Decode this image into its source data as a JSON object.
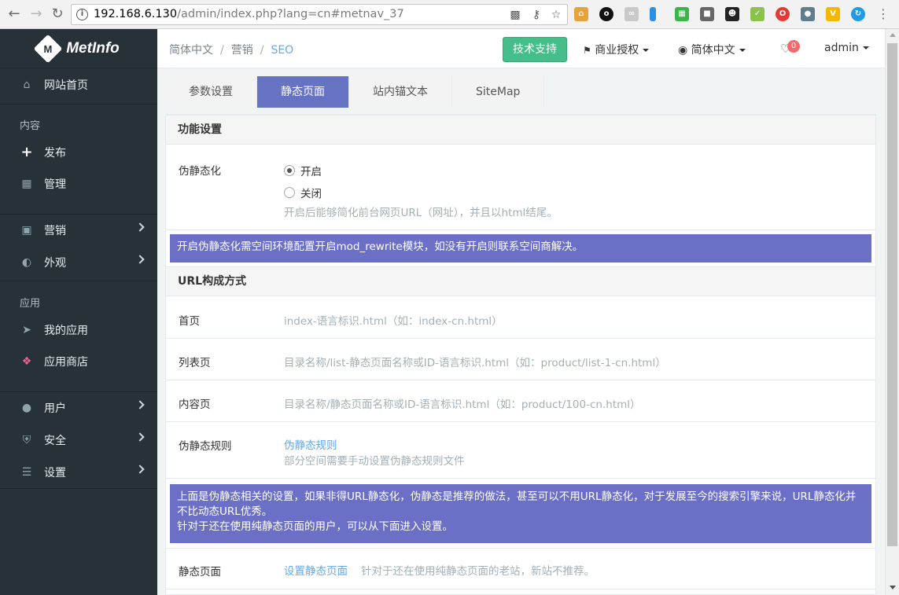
{
  "browser": {
    "url_host": "192.168.6.130",
    "url_path": "/admin/index.php?lang=cn#metnav_37"
  },
  "sidebar": {
    "brand": "MetInfo",
    "home": "网站首页",
    "group_content": "内容",
    "publish": "发布",
    "manage": "管理",
    "marketing": "营销",
    "appearance": "外观",
    "group_apps": "应用",
    "my_apps": "我的应用",
    "app_store": "应用商店",
    "users": "用户",
    "security": "安全",
    "settings": "设置"
  },
  "topbar": {
    "breadcrumb": [
      "简体中文",
      "营销",
      "SEO"
    ],
    "support_button": "技术支持",
    "license": "商业授权",
    "language": "简体中文",
    "notification_count": "0",
    "user": "admin"
  },
  "tabs": [
    "参数设置",
    "静态页面",
    "站内锚文本",
    "SiteMap"
  ],
  "active_tab": 1,
  "content": {
    "section1_title": "功能设置",
    "pseudo_static_label": "伪静态化",
    "option_on": "开启",
    "option_off": "关闭",
    "pseudo_static_hint": "开启后能够简化前台网页URL（网址），并且以html结尾。",
    "alert1": "开启伪静态化需空间环境配置开启mod_rewrite模块，如没有开启则联系空间商解决。",
    "section2_title": "URL构成方式",
    "home_label": "首页",
    "home_value": "index-语言标识.html（如：index-cn.html）",
    "list_label": "列表页",
    "list_value": "目录名称/list-静态页面名称或ID-语言标识.html（如：product/list-1-cn.html）",
    "detail_label": "内容页",
    "detail_value": "目录名称/静态页面名称或ID-语言标识.html（如：product/100-cn.html）",
    "rules_label": "伪静态规则",
    "rules_link": "伪静态规则",
    "rules_hint": "部分空间需要手动设置伪静态规则文件",
    "alert2_line1": "上面是伪静态相关的设置，如果非得URL静态化，伪静态是推荐的做法，甚至可以不用URL静态化，对于发展至今的搜索引擎来说，URL静态化并不比动态URL优秀。",
    "alert2_line2": "针对于还在使用纯静态页面的用户，可以从下面进入设置。",
    "static_label": "静态页面",
    "static_link": "设置静态页面",
    "static_hint": "针对于还在使用纯静态页面的老站，新站不推荐。"
  }
}
